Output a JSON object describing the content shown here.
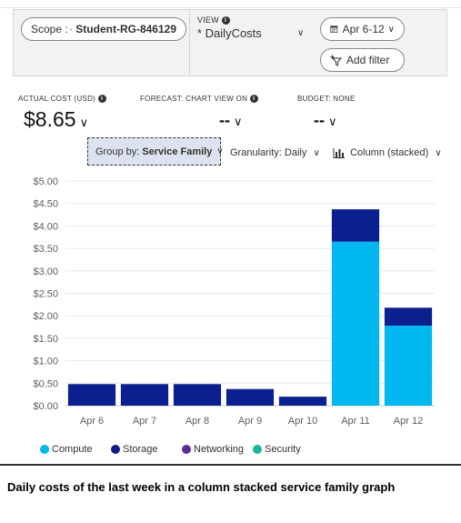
{
  "toolbar": {
    "scope_label": "Scope :",
    "scope_value": "Student-RG-846129",
    "view_label": "VIEW",
    "view_value": "* DailyCosts",
    "date_range": "Apr 6-12",
    "add_filter": "Add filter"
  },
  "kpis": {
    "actual_label": "ACTUAL COST (USD)",
    "actual_value": "$8.65",
    "forecast_label": "FORECAST: CHART VIEW ON",
    "forecast_value": "--",
    "budget_label": "BUDGET: NONE",
    "budget_value": "--"
  },
  "controls": {
    "group_by_label": "Group by:",
    "group_by_value": "Service Family",
    "granularity_label": "Granularity:",
    "granularity_value": "Daily",
    "chart_type_value": "Column (stacked)"
  },
  "chart_data": {
    "type": "bar",
    "stacked": true,
    "categories": [
      "Apr 6",
      "Apr 7",
      "Apr 8",
      "Apr 9",
      "Apr 10",
      "Apr 11",
      "Apr 12"
    ],
    "series": [
      {
        "name": "Compute",
        "color": "#00b7f0",
        "values": [
          0,
          0,
          0,
          0,
          0,
          3.65,
          1.78
        ]
      },
      {
        "name": "Storage",
        "color": "#0b1f8e",
        "values": [
          0.48,
          0.48,
          0.48,
          0.37,
          0.2,
          0.72,
          0.4
        ]
      },
      {
        "name": "Networking",
        "color": "#5c2d91",
        "values": [
          0,
          0,
          0,
          0,
          0,
          0,
          0
        ]
      },
      {
        "name": "Security",
        "color": "#1bb39a",
        "values": [
          0,
          0,
          0,
          0,
          0,
          0,
          0
        ]
      }
    ],
    "y_ticks": [
      "$0.00",
      "$0.50",
      "$1.00",
      "$1.50",
      "$2.00",
      "$2.50",
      "$3.00",
      "$3.50",
      "$4.00",
      "$4.50",
      "$5.00"
    ],
    "ylim": [
      0,
      5
    ],
    "grid": true,
    "legend": "bottom"
  },
  "caption": "Daily costs of the last week in a column stacked service family graph"
}
